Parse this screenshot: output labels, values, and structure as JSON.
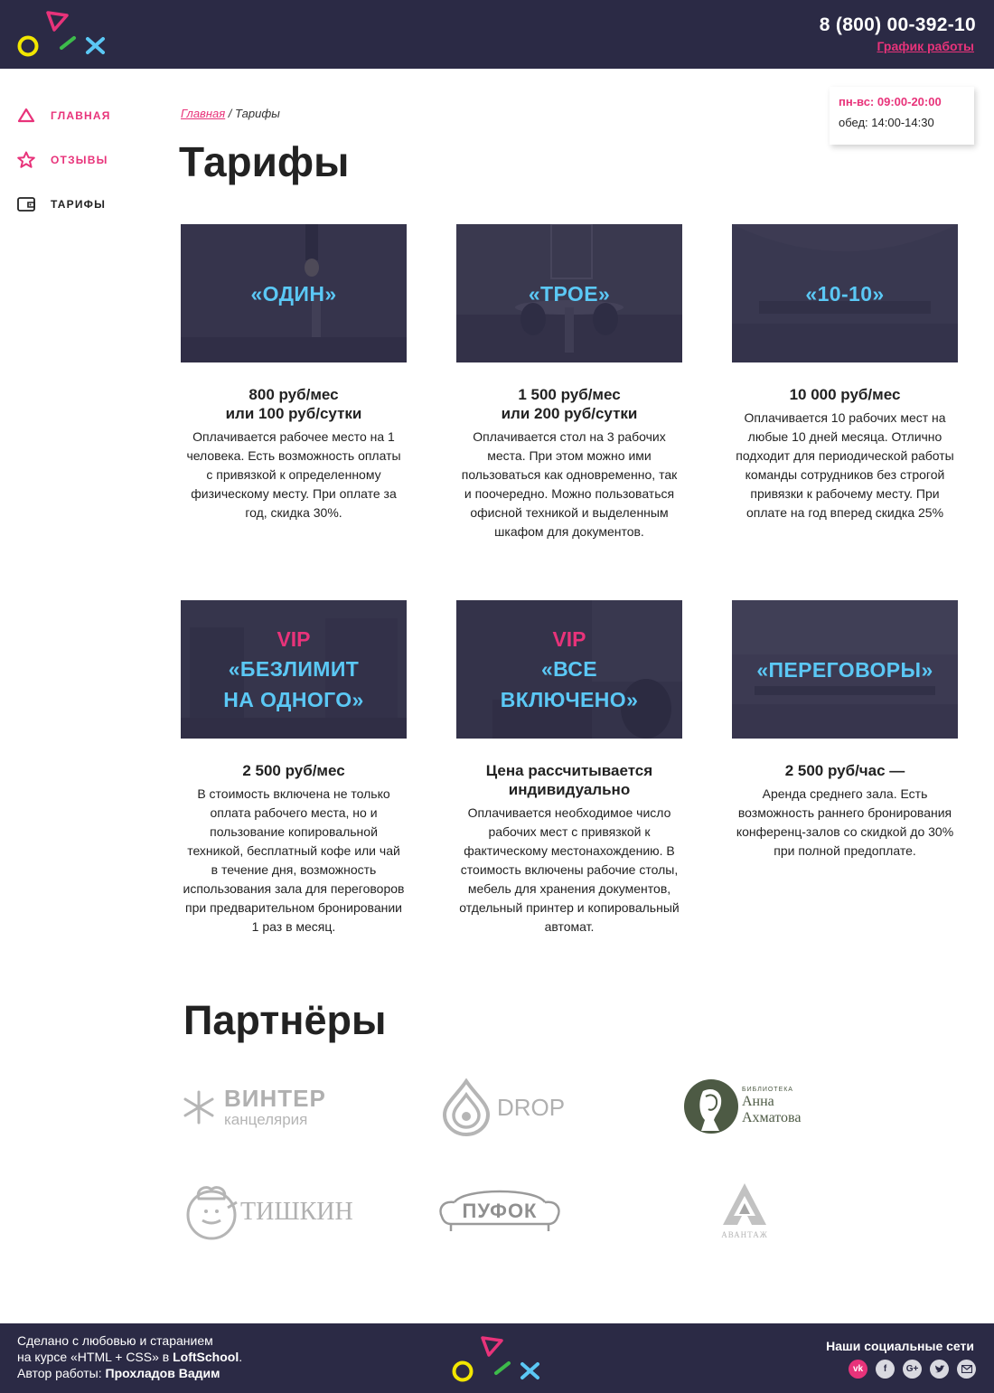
{
  "header": {
    "phone": "8 (800) 00-392-10",
    "schedule_link": "График работы"
  },
  "sidebar": {
    "items": [
      {
        "label": "ГЛАВНАЯ",
        "icon": "triangle-icon"
      },
      {
        "label": "ОТЗЫВЫ",
        "icon": "star-icon"
      },
      {
        "label": "ТАРИФЫ",
        "icon": "wallet-icon"
      }
    ]
  },
  "hours": {
    "main": "пн-вс: 09:00-20:00",
    "lunch": "обед: 14:00-14:30"
  },
  "breadcrumb": {
    "home": "Главная",
    "separator": " / ",
    "current": "Тарифы"
  },
  "page_title": "Тарифы",
  "tariffs": [
    {
      "vip": "",
      "name_lines": [
        "«ОДИН»"
      ],
      "price_lines": [
        "800 руб/мес",
        "или 100 руб/сутки"
      ],
      "desc": "Оплачивается рабочее место на 1 человека. Есть возможность оплаты с привязкой к определенному физическому месту. При оплате за год, скидка 30%."
    },
    {
      "vip": "",
      "name_lines": [
        "«ТРОЕ»"
      ],
      "price_lines": [
        "1 500 руб/мес",
        "или 200 руб/сутки"
      ],
      "desc": "Оплачивается стол на 3 рабочих места. При этом можно ими пользоваться как одновременно, так и поочередно. Можно пользоваться офисной техникой и выделенным шкафом для документов."
    },
    {
      "vip": "",
      "name_lines": [
        "«10-10»"
      ],
      "price_lines": [
        "10 000 руб/мес"
      ],
      "desc": "Оплачивается 10 рабочих мест на любые 10 дней месяца. Отлично подходит для периодической работы команды сотрудников без строгой привязки к рабочему месту. При оплате на год вперед скидка 25%"
    },
    {
      "vip": "VIP",
      "name_lines": [
        "«БЕЗЛИМИТ",
        "НА ОДНОГО»"
      ],
      "price_lines": [
        "2 500 руб/мес"
      ],
      "desc": "В стоимость включена не только оплата рабочего места, но и пользование копировальной техникой, бесплатный кофе или чай в течение дня, возможность использования зала для переговоров при предварительном бронировании 1 раз в месяц."
    },
    {
      "vip": "VIP",
      "name_lines": [
        "«ВСЕ",
        "ВКЛЮЧЕНО»"
      ],
      "price_lines": [
        "Цена рассчитывается",
        "индивидуально"
      ],
      "desc": "Оплачивается необходимое число рабочих мест с привязкой к фактическому местонахождению. В стоимость включены рабочие столы, мебель для хранения документов, отдельный принтер и копировальный автомат."
    },
    {
      "vip": "",
      "name_lines": [
        "«ПЕРЕГОВОРЫ»"
      ],
      "price_lines": [
        "2 500 руб/час —"
      ],
      "desc": "Аренда среднего зала. Есть возможность раннего бронирования конференц-залов со скидкой до 30% при полной предоплате."
    }
  ],
  "partners_title": "Партнёры",
  "partners": {
    "winter": {
      "name": "ВИНТЕР",
      "sub": "канцелярия"
    },
    "drop": {
      "name": "DROP"
    },
    "library": {
      "top": "БИБЛИОТЕКА",
      "line1": "Анна",
      "line2": "Ахматова"
    },
    "tishkin": {
      "name": "ТИШКИН"
    },
    "pufok": {
      "name": "ПУФОК"
    },
    "avantazh": {
      "name": "АВАНТАЖ"
    }
  },
  "footer": {
    "line1": "Сделано с любовью и старанием",
    "line2_pre": "на курсе «HTML + CSS» в ",
    "line2_brand": "LoftSchool",
    "line2_post": ".",
    "line3_pre": "Автор работы: ",
    "line3_author": "Прохладов Вадим",
    "social_title": "Наши социальные сети",
    "social": [
      "vk-icon",
      "facebook-icon",
      "google-plus-icon",
      "twitter-icon",
      "mail-icon"
    ]
  },
  "colors": {
    "dark": "#2b2a45",
    "pink": "#e8337a",
    "blue": "#5bc8f5",
    "yellow": "#f2e600",
    "green": "#3dbb4b"
  }
}
